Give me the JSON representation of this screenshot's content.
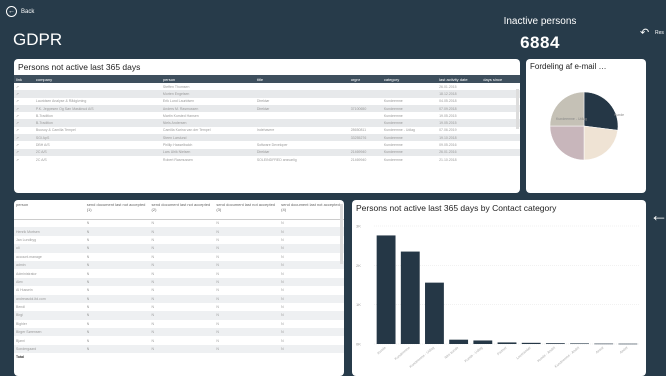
{
  "header": {
    "back_label": "Back",
    "back_icon": "←",
    "title": "GDPR",
    "kpi_label": "Inactive persons",
    "kpi_value": "6884",
    "undo_icon": "↶",
    "undo_label": "Res",
    "side_arrow": "←"
  },
  "table1": {
    "title": "Persons not active last 365 days",
    "columns": [
      "link",
      "company",
      "person",
      "title",
      "orgnr",
      "category",
      "last activity date",
      "days since"
    ],
    "rows": [
      [
        "⇗",
        "",
        "Steffen Thomsen",
        "",
        "",
        "",
        "26.01.2015",
        ""
      ],
      [
        "⇗",
        "",
        "Morten Engelsen",
        "",
        "",
        "",
        "18.12.2018",
        ""
      ],
      [
        "⇗",
        "Lauridsen Analyse & Rådgivning",
        "Erik Lund Lauridsen",
        "Direktør",
        "",
        "Kundeemne",
        "04.05.2018",
        ""
      ],
      [
        "⇗",
        "P.K. Jeppesen Og Søn Maskinud A/S",
        "Anders M. Rasmussen",
        "Direktør",
        "37100650",
        "Kundeemne",
        "07.09.2018",
        ""
      ],
      [
        "⇗",
        "B-Tradition",
        "Martin Kursted Hansen",
        "",
        "",
        "Kundeemne",
        "19.05.2015",
        ""
      ],
      [
        "⇗",
        "B-Tradition",
        "Niels Andersen",
        "",
        "",
        "Kundeemne",
        "19.05.2015",
        ""
      ],
      [
        "⇗",
        "Buusoy & Camilla Tempel",
        "Camilla Karina van der Tempel",
        "Indehavere",
        "28650811",
        "Kundeemne - Udlag",
        "07.06.2019",
        ""
      ],
      [
        "⇗",
        "SGI ApS",
        "Steen Larslund",
        "",
        "33255276",
        "Kundeemne",
        "19.10.2018",
        ""
      ],
      [
        "⇗",
        "DBH A/S",
        "Phillip Hasselbalch",
        "Software Developer",
        "",
        "Kundeemne",
        "09.05.2016",
        ""
      ],
      [
        "⇗",
        "2C A/S",
        "Lars Ulrik Nielsen",
        "Direktør",
        "21469940",
        "Kundeemne",
        "26.01.2016",
        ""
      ],
      [
        "⇗",
        "2C A/S",
        "Robert Rasmussen",
        "SOLEINDFRED ansvarlig",
        "21469940",
        "Kundeemne",
        "21.10.2018",
        ""
      ]
    ]
  },
  "pie": {
    "title": "Fordeling af e-mail …",
    "labels": [
      "Kundeemne",
      "Kunde",
      "Ikke kunde",
      "Kundeemne - Udlag"
    ],
    "colors": [
      "#253746",
      "#efe3d4",
      "#c8b6bb",
      "#c5c1b6"
    ],
    "shares": [
      0.27,
      0.23,
      0.25,
      0.25
    ],
    "label_texts": [
      "Kundeemne",
      "Kunde",
      "Ikke kunde",
      "Kundeemne - Udlag"
    ]
  },
  "table2": {
    "columns": [
      "person",
      "send document last not accepted (1)",
      "send document last not accepted (2)",
      "send document last not accepted (3)",
      "send document last not accepted (4)"
    ],
    "rows": [
      [
        "",
        "N",
        "N",
        "N",
        "N"
      ],
      [
        "Henrik Mortsen",
        "N",
        "N",
        "N",
        "N"
      ],
      [
        "Jan Lundbyg",
        "N",
        "N",
        "N",
        "N"
      ],
      [
        "oli",
        "N",
        "N",
        "N",
        "N"
      ],
      [
        "account.manage",
        "N",
        "N",
        "N",
        "N"
      ],
      [
        "admin",
        "N",
        "N",
        "N",
        "N"
      ],
      [
        "Administrator",
        "N",
        "N",
        "N",
        "N"
      ],
      [
        "Alex",
        "N",
        "N",
        "N",
        "N"
      ],
      [
        "Al Hussein",
        "N",
        "N",
        "N",
        "N"
      ],
      [
        "andreasdol-ltd.com",
        "N",
        "N",
        "N",
        "N"
      ],
      [
        "Bendl",
        "N",
        "N",
        "N",
        "N"
      ],
      [
        "Birgi",
        "N",
        "N",
        "N",
        "N"
      ],
      [
        "Bighler",
        "N",
        "N",
        "N",
        "N"
      ],
      [
        "Birger Sørensen",
        "N",
        "N",
        "N",
        "N"
      ],
      [
        "Bjarni",
        "N",
        "N",
        "N",
        "N"
      ],
      [
        "Sondergaard",
        "N",
        "N",
        "N",
        "N"
      ]
    ],
    "total_label": "Total"
  },
  "bar_panel": {
    "title": "Persons not active last 365 days by Contact category"
  },
  "chart_data": {
    "type": "bar",
    "title": "Persons not active last 365 days by Contact category",
    "categories": [
      "Kunde",
      "Kundeemne",
      "Kundeemne - Udlag",
      "Ikke kunde",
      "Kunde - Udlag",
      "Partner",
      "Leverandør",
      "Kunde - Andet",
      "Kundeemne - Andet",
      "Ansat",
      "Andet"
    ],
    "values": [
      2760,
      2350,
      1560,
      110,
      90,
      40,
      30,
      20,
      15,
      10,
      8
    ],
    "ylim": [
      0,
      3000
    ],
    "yticks": [
      0,
      1000,
      2000,
      3000
    ],
    "ytick_labels": [
      "0K",
      "1K",
      "2K",
      "3K"
    ],
    "bar_color": "#253746",
    "grid": true
  }
}
